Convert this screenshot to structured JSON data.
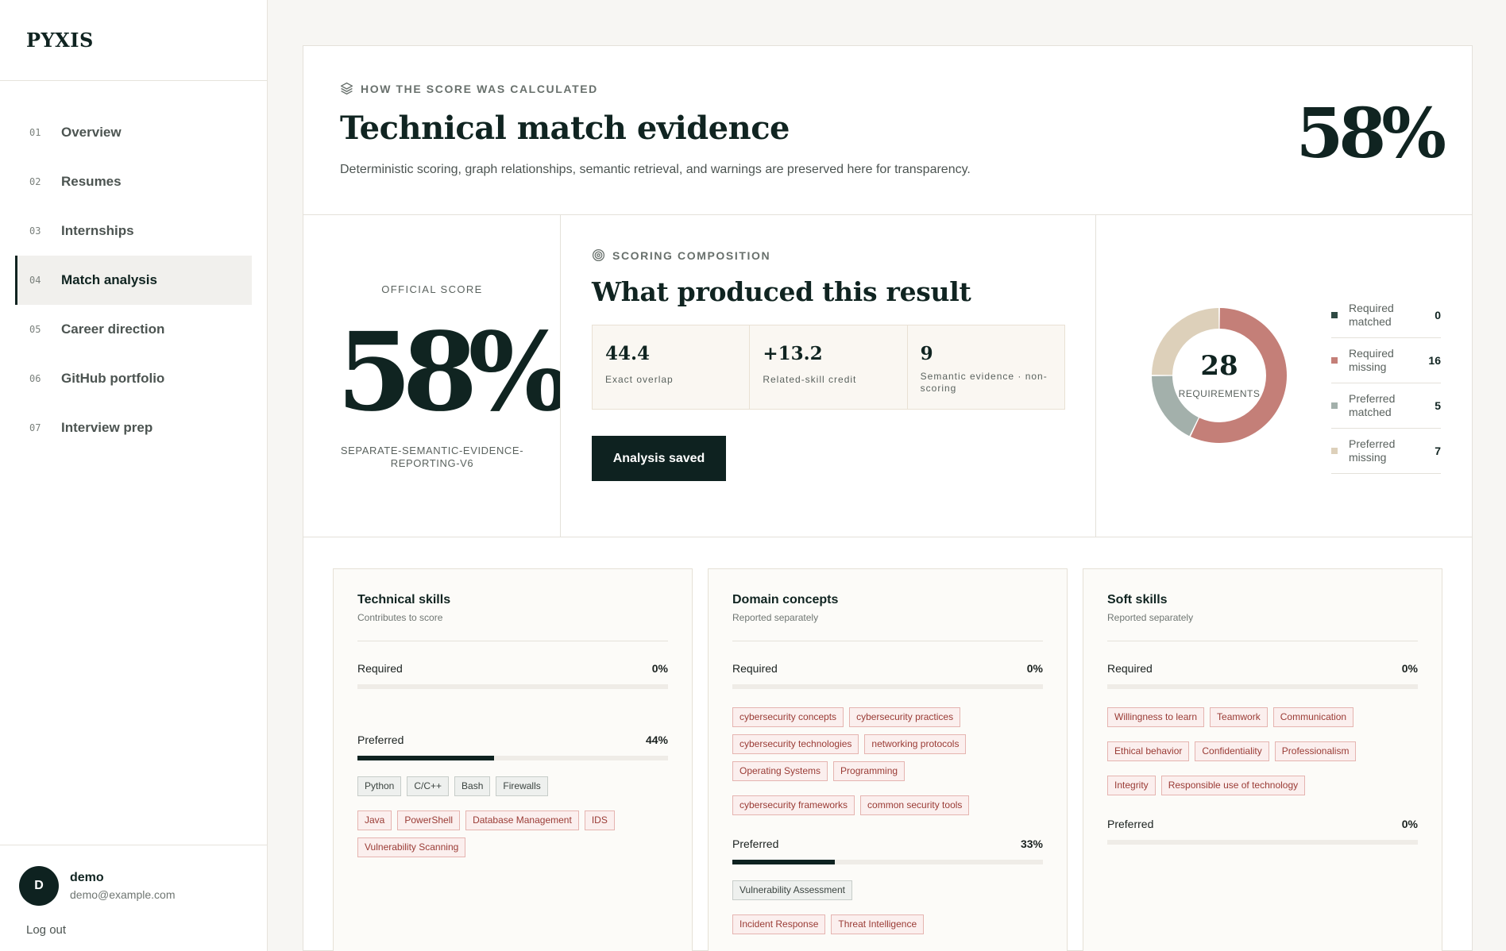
{
  "brand": "PYXIS",
  "nav": [
    {
      "num": "01",
      "label": "Overview"
    },
    {
      "num": "02",
      "label": "Resumes"
    },
    {
      "num": "03",
      "label": "Internships"
    },
    {
      "num": "04",
      "label": "Match analysis"
    },
    {
      "num": "05",
      "label": "Career direction"
    },
    {
      "num": "06",
      "label": "GitHub portfolio"
    },
    {
      "num": "07",
      "label": "Interview prep"
    }
  ],
  "user": {
    "initial": "D",
    "name": "demo",
    "email": "demo@example.com",
    "logout": "Log out"
  },
  "hero": {
    "eyebrow": "HOW THE SCORE WAS CALCULATED",
    "title": "Technical match evidence",
    "subtitle": "Deterministic scoring, graph relationships, semantic retrieval, and warnings are preserved here for transparency.",
    "score": "58%"
  },
  "official": {
    "label": "OFFICIAL SCORE",
    "score": "58%",
    "version": "SEPARATE-SEMANTIC-EVIDENCE-REPORTING-V6"
  },
  "composition": {
    "eyebrow": "SCORING COMPOSITION",
    "title": "What produced this result",
    "metrics": [
      {
        "value": "44.4",
        "label": "Exact overlap"
      },
      {
        "value": "+13.2",
        "label": "Related-skill credit"
      },
      {
        "value": "9",
        "label": "Semantic evidence · non-scoring"
      }
    ],
    "button": "Analysis saved"
  },
  "requirements": {
    "total": "28",
    "caption": "REQUIREMENTS",
    "legend": [
      {
        "label": "Required matched",
        "value": "0",
        "color": "#2f4a43"
      },
      {
        "label": "Required missing",
        "value": "16",
        "color": "#c47f78"
      },
      {
        "label": "Preferred matched",
        "value": "5",
        "color": "#a3b0ab"
      },
      {
        "label": "Preferred missing",
        "value": "7",
        "color": "#ddd0ba"
      }
    ]
  },
  "panels": {
    "technical": {
      "title": "Technical skills",
      "subtitle": "Contributes to score",
      "required_label": "Required",
      "required_pct": "0%",
      "required_value": 0,
      "preferred_label": "Preferred",
      "preferred_pct": "44%",
      "preferred_value": 0.44,
      "preferred_matched": [
        "Python",
        "C/C++",
        "Bash",
        "Firewalls"
      ],
      "preferred_missing": [
        "Java",
        "PowerShell",
        "Database Management",
        "IDS",
        "Vulnerability Scanning"
      ]
    },
    "domain": {
      "title": "Domain concepts",
      "subtitle": "Reported separately",
      "required_label": "Required",
      "required_pct": "0%",
      "required_value": 0,
      "required_missing": [
        "cybersecurity concepts",
        "cybersecurity practices",
        "cybersecurity technologies",
        "networking protocols",
        "Operating Systems",
        "Programming",
        "cybersecurity frameworks",
        "common security tools"
      ],
      "preferred_label": "Preferred",
      "preferred_pct": "33%",
      "preferred_value": 0.33,
      "preferred_matched": [
        "Vulnerability Assessment"
      ],
      "preferred_missing": [
        "Incident Response",
        "Threat Intelligence"
      ]
    },
    "soft": {
      "title": "Soft skills",
      "subtitle": "Reported separately",
      "required_label": "Required",
      "required_pct": "0%",
      "required_value": 0,
      "required_missing": [
        "Willingness to learn",
        "Teamwork",
        "Communication",
        "Ethical behavior",
        "Confidentiality",
        "Professionalism",
        "Integrity",
        "Responsible use of technology"
      ],
      "preferred_label": "Preferred",
      "preferred_pct": "0%",
      "preferred_value": 0
    }
  }
}
